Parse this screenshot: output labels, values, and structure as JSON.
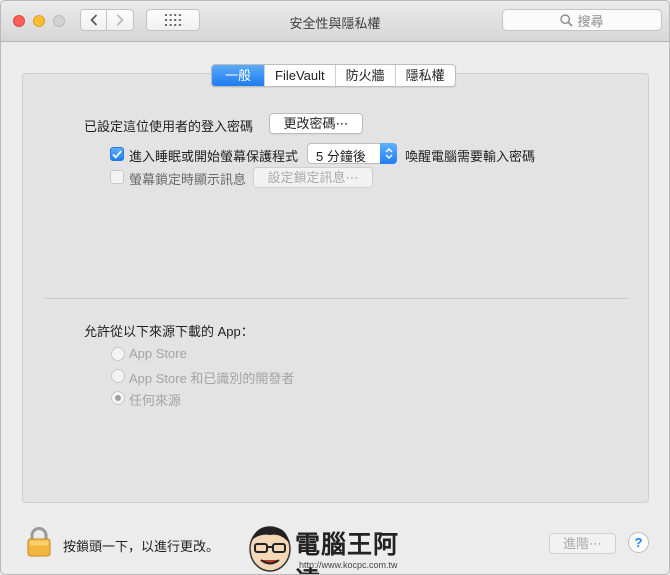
{
  "window": {
    "title": "安全性與隱私權"
  },
  "toolbar": {
    "search_placeholder": "搜尋"
  },
  "tabs": [
    {
      "label": "一般",
      "active": true
    },
    {
      "label": "FileVault",
      "active": false
    },
    {
      "label": "防火牆",
      "active": false
    },
    {
      "label": "隱私權",
      "active": false
    }
  ],
  "general": {
    "password_set_label": "已設定這位使用者的登入密碼",
    "change_password_button": "更改密碼⋯",
    "require_password": {
      "checked": true,
      "label_before": "進入睡眠或開始螢幕保護程式",
      "delay_value": "5 分鐘後",
      "label_after": "喚醒電腦需要輸入密碼"
    },
    "lock_message": {
      "checked": false,
      "label": "螢幕鎖定時顯示訊息",
      "button": "設定鎖定訊息⋯"
    }
  },
  "downloads": {
    "heading": "允許從以下來源下載的 App：",
    "options": [
      {
        "label": "App Store",
        "selected": false
      },
      {
        "label": "App Store 和已識別的開發者",
        "selected": false
      },
      {
        "label": "任何來源",
        "selected": true
      }
    ]
  },
  "footer": {
    "lock_text": "按鎖頭一下，以進行更改。",
    "advanced_button": "進階⋯",
    "help_label": "?"
  },
  "watermark": {
    "logo": "電腦王阿達",
    "url": "http://www.kocpc.com.tw"
  },
  "colors": {
    "accent": "#1f7ef3",
    "panel": "#e3e3e3",
    "window": "#ececec"
  }
}
